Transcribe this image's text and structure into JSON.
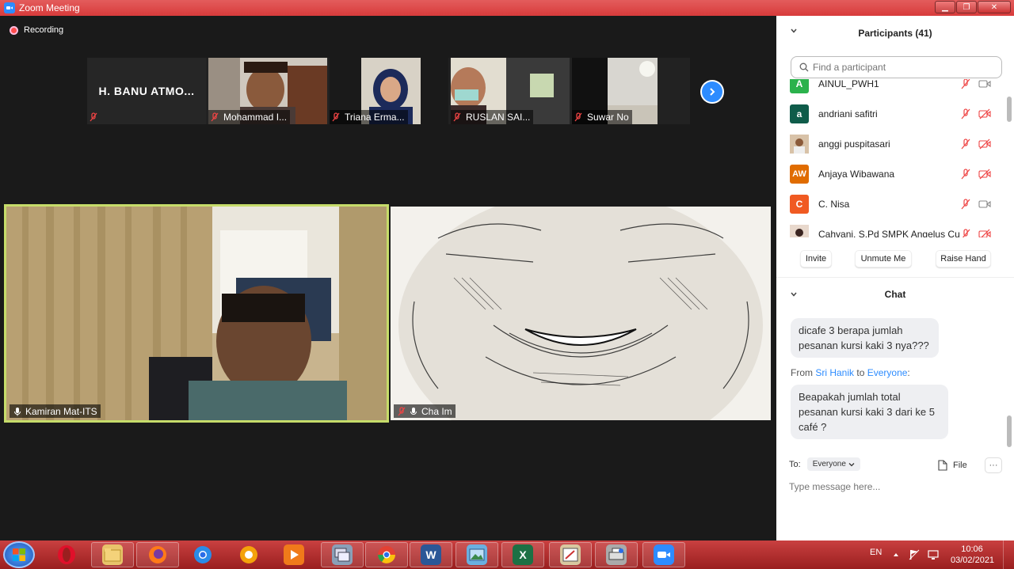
{
  "window": {
    "title": "Zoom Meeting",
    "minimize": "▁",
    "maximize": "❐",
    "close": "✕"
  },
  "meeting": {
    "recording_label": "Recording",
    "thumbnails": [
      {
        "name": "H. BANU ATMO...",
        "label": ""
      },
      {
        "name": "Mohammad I..."
      },
      {
        "name": "Triana Erma..."
      },
      {
        "name": "RUSLAN SAI..."
      },
      {
        "name": "Suwar No"
      }
    ],
    "main_videos": [
      {
        "name": "Kamiran Mat-ITS"
      },
      {
        "name": "Cha Im"
      }
    ]
  },
  "participants": {
    "title": "Participants (41)",
    "search_placeholder": "Find a participant",
    "list": [
      {
        "name": "AINUL_PWH1",
        "initials": "A",
        "color": "#2bb24c"
      },
      {
        "name": "andriani safitri",
        "initials": "a",
        "color": "#0f5c4a"
      },
      {
        "name": "anggi puspitasari",
        "initials": "",
        "color": "#c9a88a"
      },
      {
        "name": "Anjaya Wibawana",
        "initials": "AW",
        "color": "#e06c00"
      },
      {
        "name": "C. Nisa",
        "initials": "C",
        "color": "#f05a22"
      },
      {
        "name": "Cahyani, S.Pd SMPK Angelus Cu",
        "initials": "",
        "color": "#d8b8a8"
      }
    ],
    "actions": {
      "invite": "Invite",
      "unmute": "Unmute Me",
      "raise_hand": "Raise Hand"
    }
  },
  "chat": {
    "title": "Chat",
    "messages": [
      {
        "text_line1": "dicafe 3 berapa jumlah",
        "text_line2": "pesanan kursi kaki 3 nya???"
      },
      {
        "from_prefix": "From ",
        "from": "Sri Hanik",
        "to_word": " to ",
        "to": "Everyone",
        "suffix": ":",
        "text_line1": "Beapakah jumlah total",
        "text_line2": "pesanan kursi kaki 3 dari ke 5",
        "text_line3": "café ?"
      }
    ],
    "to_label": "To:",
    "recipient": "Everyone",
    "file_label": "File",
    "more_label": "···",
    "input_placeholder": "Type message here..."
  },
  "taskbar": {
    "language": "EN",
    "time": "10:06",
    "date": "03/02/2021"
  }
}
